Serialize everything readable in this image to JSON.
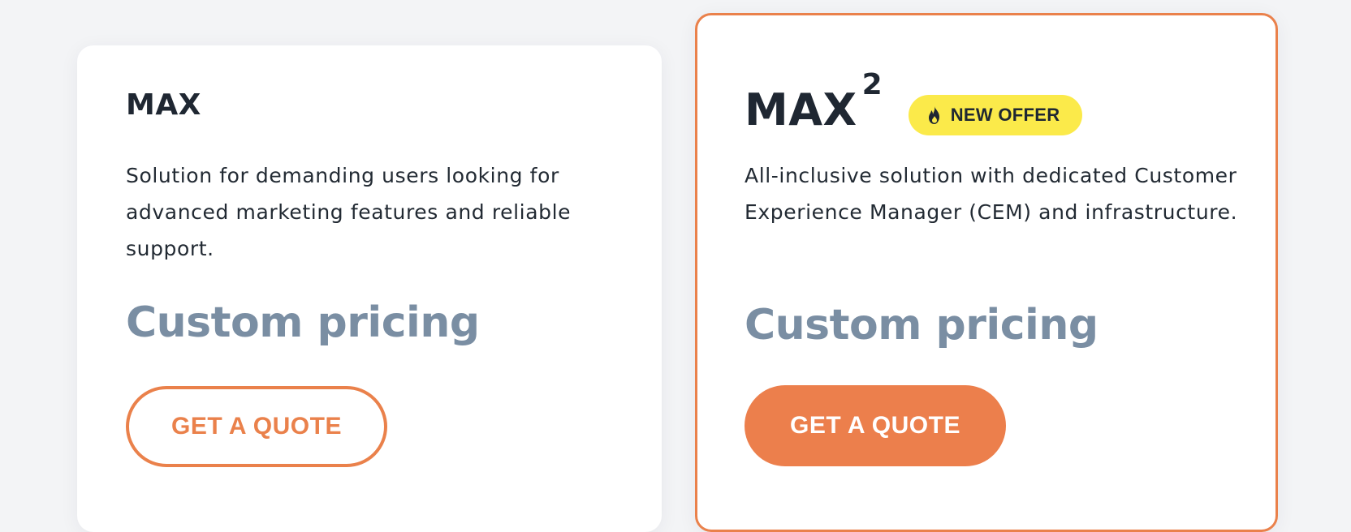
{
  "plans": {
    "max": {
      "title": "MAX",
      "description": "Solution for demanding users looking for advanced marketing features and reliable support.",
      "price": "Custom pricing",
      "cta_label": "GET A QUOTE"
    },
    "max2": {
      "title": "MAX",
      "superscript": "2",
      "badge": "NEW OFFER",
      "badge_icon": "fire-icon",
      "description": "All-inclusive solution with dedicated Customer Experience Manager (CEM) and infrastructure.",
      "price": "Custom pricing",
      "cta_label": "GET A QUOTE"
    }
  },
  "colors": {
    "accent": "#ea814b",
    "badge_bg": "#fbea4a",
    "title": "#1f2732",
    "price": "#7a8ea3",
    "page_bg": "#f3f4f6"
  }
}
